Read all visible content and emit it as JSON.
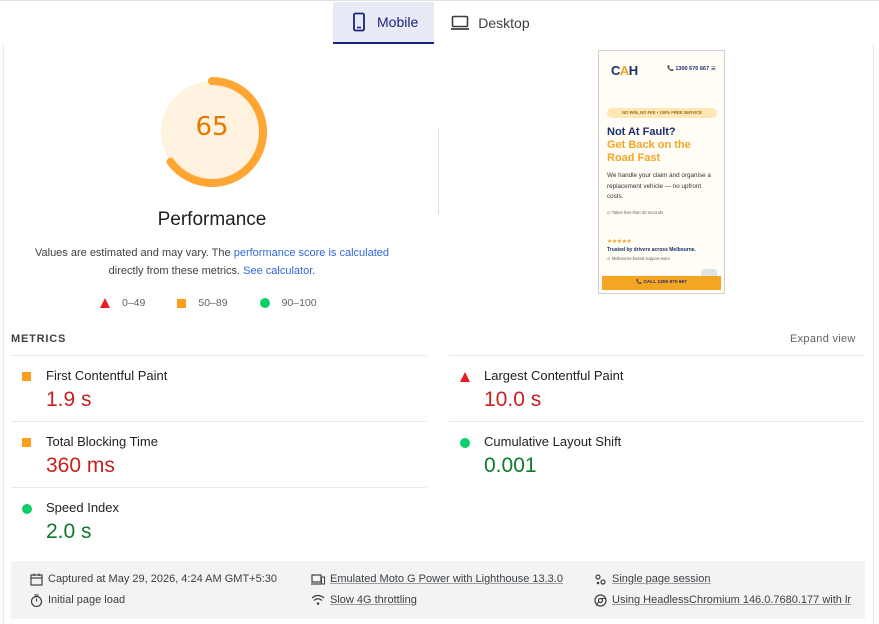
{
  "tabs": [
    {
      "label": "Mobile",
      "active": true,
      "icon": "mobile-icon"
    },
    {
      "label": "Desktop",
      "active": false,
      "icon": "desktop-icon"
    }
  ],
  "performance": {
    "score": "65",
    "score_fraction": 0.65,
    "title": "Performance",
    "desc_prefix": "Values are estimated and may vary. The ",
    "desc_link1": "performance score is calculated",
    "desc_middle": " directly from these metrics. ",
    "desc_link2": "See calculator",
    "desc_suffix": ".",
    "score_color": "#e67700",
    "gauge_color": "#ffa534",
    "gauge_bg_color": "#fff3e0"
  },
  "legend": [
    {
      "range": "0–49",
      "shape": "triangle",
      "color": "#eb1c24"
    },
    {
      "range": "50–89",
      "shape": "square",
      "color": "#fa9e1b"
    },
    {
      "range": "90–100",
      "shape": "circle",
      "color": "#0cce6b"
    }
  ],
  "preview": {
    "logo_c": "C",
    "logo_a": "A",
    "logo_h": "H",
    "phone": "📞 1300 670 667",
    "menu": "≡",
    "badge": "NO WIN, NO FEE • 100% FREE SERVICE",
    "heading_1": "Not At Fault?",
    "heading_2": "Get Back on the Road Fast",
    "body": "We handle your claim and organise a replacement vehicle — no upfront costs.",
    "small": "◷ Takes less than 30 seconds",
    "stars": "★★★★★",
    "trust": "Trusted by drivers across Melbourne.",
    "support": "⊙ Melbourne-based support team",
    "call": "📞 CALL 1300 670 667"
  },
  "metrics": {
    "title": "METRICS",
    "expand": "Expand view",
    "items": [
      {
        "label": "First Contentful Paint",
        "value": "1.9 s",
        "status": "average"
      },
      {
        "label": "Largest Contentful Paint",
        "value": "10.0 s",
        "status": "fail"
      },
      {
        "label": "Total Blocking Time",
        "value": "360 ms",
        "status": "average"
      },
      {
        "label": "Cumulative Layout Shift",
        "value": "0.001",
        "status": "pass"
      },
      {
        "label": "Speed Index",
        "value": "2.0 s",
        "status": "pass"
      }
    ]
  },
  "footer": {
    "captured": "Captured at May 29, 2026, 4:24 AM GMT+5:30",
    "initial": "Initial page load",
    "emulated": "Emulated Moto G Power with Lighthouse 13.3.0",
    "throttling": "Slow 4G throttling",
    "session": "Single page session",
    "browser": "Using HeadlessChromium 146.0.7680.177 with lr"
  }
}
